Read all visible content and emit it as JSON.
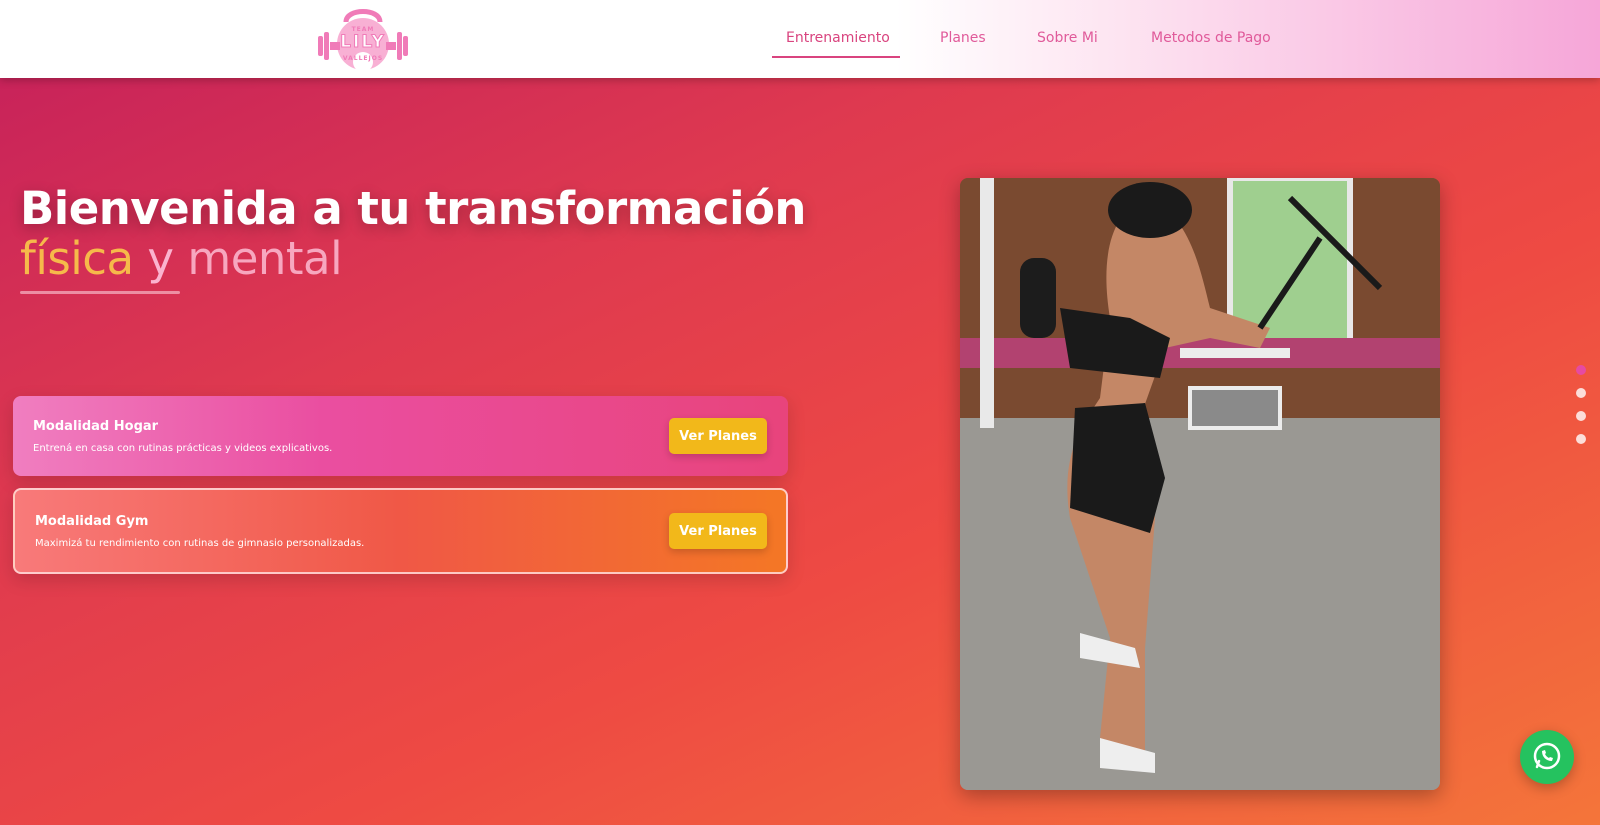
{
  "logo": {
    "small": "TEAM",
    "big": "LILY",
    "sub": "VALLEJOS",
    "icon": "kettlebell-icon"
  },
  "nav": {
    "items": [
      {
        "label": "Entrenamiento",
        "active": true
      },
      {
        "label": "Planes"
      },
      {
        "label": "Sobre Mi"
      },
      {
        "label": "Metodos de Pago"
      }
    ]
  },
  "hero": {
    "title": "Bienvenida a tu transformación",
    "subtitle_words": [
      "física",
      "y",
      "mental"
    ],
    "colors": {
      "word1": "#f6b94a",
      "word2": "#fbb3cf",
      "word3": "#f7a7bf"
    }
  },
  "cards": [
    {
      "title": "Modalidad Hogar",
      "description": "Entrená en casa con rutinas prácticas y videos explicativos.",
      "button": "Ver Planes"
    },
    {
      "title": "Modalidad Gym",
      "description": "Maximizá tu rendimiento con rutinas de gimnasio personalizadas.",
      "button": "Ver Planes"
    }
  ],
  "photo": {
    "icon": "training-photo"
  },
  "carousel": {
    "dots": 4,
    "active_index": 0
  },
  "whatsapp": {
    "icon": "whatsapp-icon"
  },
  "colors": {
    "accent": "#e05a9a",
    "button": "#f2b81a",
    "whatsapp": "#25c25f"
  }
}
